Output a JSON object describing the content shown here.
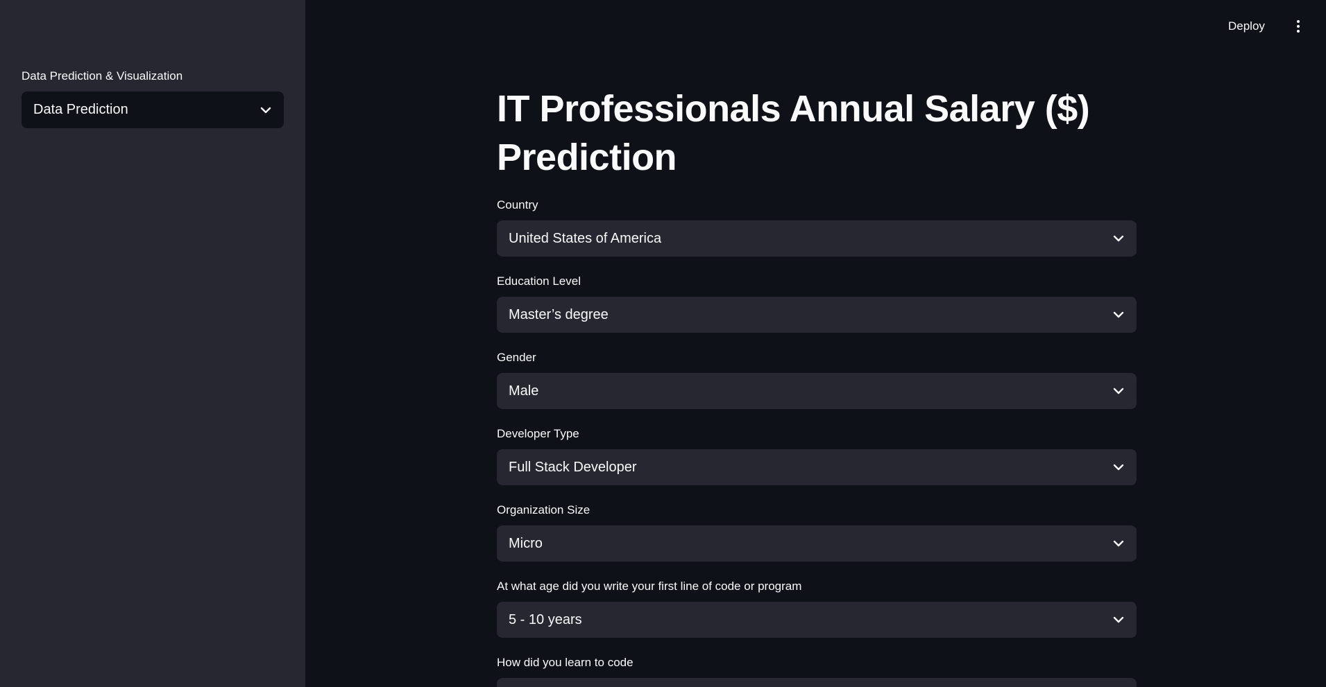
{
  "sidebar": {
    "label": "Data Prediction & Visualization",
    "select_value": "Data Prediction",
    "select_icon": "chevron-down-icon"
  },
  "header": {
    "deploy_label": "Deploy",
    "menu_icon": "kebab-menu-icon"
  },
  "main": {
    "title": "IT Professionals Annual Salary ($) Prediction",
    "fields": [
      {
        "label": "Country",
        "value": "United States of America"
      },
      {
        "label": "Education Level",
        "value": "Master’s degree"
      },
      {
        "label": "Gender",
        "value": "Male"
      },
      {
        "label": "Developer Type",
        "value": "Full Stack Developer"
      },
      {
        "label": "Organization Size",
        "value": "Micro"
      },
      {
        "label": "At what age did you write your first line of code or program",
        "value": "5 - 10 years"
      },
      {
        "label": "How did you learn to code",
        "value": ""
      }
    ]
  },
  "colors": {
    "background": "#0e1117",
    "sidebar": "#262730",
    "input": "#262730",
    "text": "#fafafa"
  }
}
